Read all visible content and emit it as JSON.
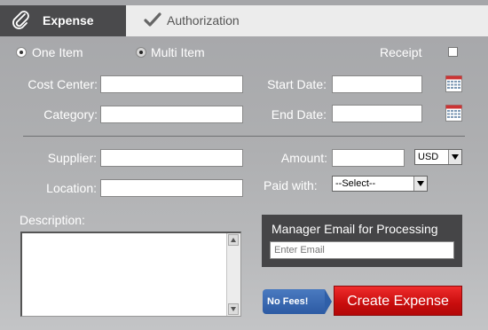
{
  "tabs": {
    "expense": "Expense",
    "authorization": "Authorization"
  },
  "item_mode": {
    "one_item": "One Item",
    "multi_item": "Multi Item",
    "selected": "one_item"
  },
  "receipt": {
    "label": "Receipt",
    "checked": false
  },
  "fields": {
    "cost_center": {
      "label": "Cost Center:",
      "value": ""
    },
    "category": {
      "label": "Category:",
      "value": ""
    },
    "start_date": {
      "label": "Start Date:",
      "value": ""
    },
    "end_date": {
      "label": "End Date:",
      "value": ""
    },
    "supplier": {
      "label": "Supplier:",
      "value": ""
    },
    "location": {
      "label": "Location:",
      "value": ""
    },
    "amount": {
      "label": "Amount:",
      "value": ""
    },
    "currency": {
      "selected": "USD"
    },
    "paid_with": {
      "label": "Paid with:",
      "selected": "--Select--"
    },
    "description": {
      "label": "Description:",
      "value": ""
    }
  },
  "manager": {
    "title": "Manager Email for Processing",
    "placeholder": "Enter Email"
  },
  "badge": {
    "label": "No Fees!"
  },
  "submit": {
    "label": "Create Expense"
  },
  "colors": {
    "tab_active_bg": "#4a4a4c",
    "tab_inactive_bg": "#ececec",
    "accent_red": "#d01414",
    "badge_blue": "#2c5aa3",
    "manager_box_bg": "#454547"
  },
  "icons": {
    "expense_tab": "paperclip-icon",
    "authorization_tab": "checkmark-icon",
    "date_picker": "calendar-icon"
  }
}
